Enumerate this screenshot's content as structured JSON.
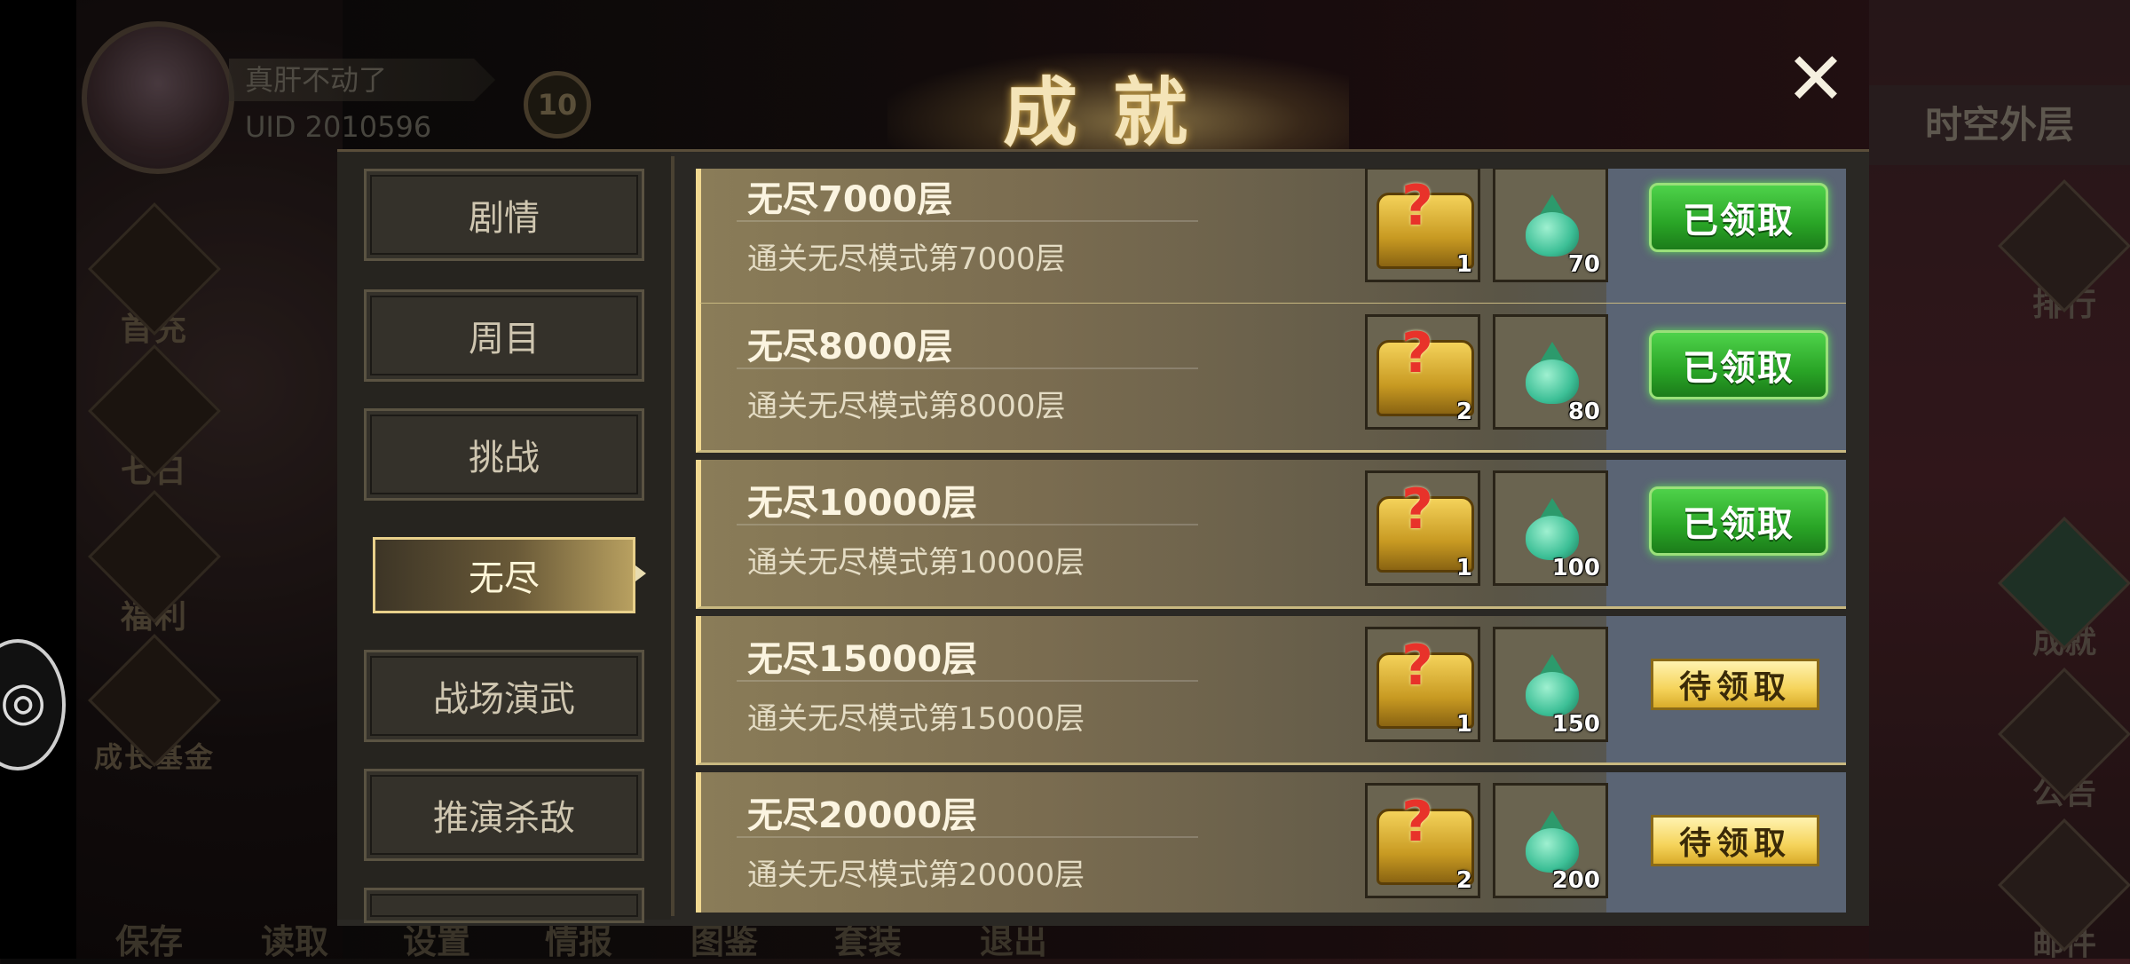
{
  "player": {
    "name": "真肝不动了",
    "uid": "UID  2010596",
    "level": "10"
  },
  "left_menu": [
    {
      "label": "首充",
      "icon": "gift-box-icon"
    },
    {
      "label": "七日",
      "icon": "scroll-icon"
    },
    {
      "label": "福利",
      "icon": "present-icon"
    },
    {
      "label": "成长基金",
      "icon": "gold-coins-icon"
    }
  ],
  "right_panel": {
    "title": "时空外层",
    "items": [
      {
        "label": "排行",
        "icon": "ranking-icon"
      },
      {
        "label": "成就",
        "icon": "achievement-icon"
      },
      {
        "label": "公告",
        "icon": "horn-icon"
      },
      {
        "label": "邮件",
        "icon": "mail-icon"
      }
    ]
  },
  "bottom_menu": [
    "保存",
    "读取",
    "设置",
    "情报",
    "图鉴",
    "套装",
    "退出"
  ],
  "dialog": {
    "title": "成就",
    "close_label": "✕",
    "tabs": [
      {
        "label": "剧情",
        "active": false
      },
      {
        "label": "周目",
        "active": false
      },
      {
        "label": "挑战",
        "active": false
      },
      {
        "label": "无尽",
        "active": true
      },
      {
        "label": "战场演武",
        "active": false
      },
      {
        "label": "推演杀敌",
        "active": false
      }
    ],
    "achievements": [
      {
        "title": "无尽7000层",
        "desc": "通关无尽模式第7000层",
        "chest_qty": "1",
        "jade_qty": "70",
        "status": "已领取"
      },
      {
        "title": "无尽8000层",
        "desc": "通关无尽模式第8000层",
        "chest_qty": "2",
        "jade_qty": "80",
        "status": "已领取"
      },
      {
        "title": "无尽10000层",
        "desc": "通关无尽模式第10000层",
        "chest_qty": "1",
        "jade_qty": "100",
        "status": "已领取"
      },
      {
        "title": "无尽15000层",
        "desc": "通关无尽模式第15000层",
        "chest_qty": "1",
        "jade_qty": "150",
        "status": "待领取"
      },
      {
        "title": "无尽20000层",
        "desc": "通关无尽模式第20000层",
        "chest_qty": "2",
        "jade_qty": "200",
        "status": "待领取"
      }
    ]
  },
  "colors": {
    "claimed_green": "#29a426",
    "pending_gold": "#f5d35a",
    "title_gold": "#f4e4b8"
  }
}
